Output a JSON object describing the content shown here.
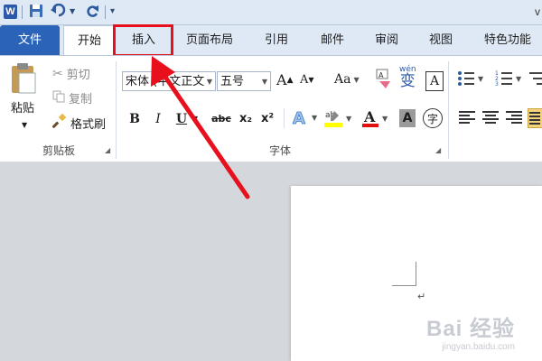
{
  "qat": {
    "logo_letter": "W",
    "title_fragment": "v"
  },
  "tabs": [
    {
      "label": "文件"
    },
    {
      "label": "开始"
    },
    {
      "label": "插入"
    },
    {
      "label": "页面布局"
    },
    {
      "label": "引用"
    },
    {
      "label": "邮件"
    },
    {
      "label": "审阅"
    },
    {
      "label": "视图"
    },
    {
      "label": "特色功能"
    }
  ],
  "clipboard": {
    "paste_label": "粘贴",
    "cut_label": "剪切",
    "copy_label": "复制",
    "format_painter_label": "格式刷",
    "group_label": "剪贴板"
  },
  "font": {
    "font_name": "宋体 (中文正文",
    "font_size": "五号",
    "group_label": "字体",
    "change_case": "Aa",
    "clear_format_text": "A",
    "pinyin_top": "wén",
    "pinyin_char": "变",
    "border_char": "A",
    "bold": "B",
    "italic": "I",
    "underline": "U",
    "strike": "abc",
    "subscript": "x₂",
    "superscript": "x²",
    "shade_char": "A",
    "enclose_char": "字"
  },
  "watermark": {
    "main": "Bai 经验",
    "sub": "jingyan.baidu.com"
  },
  "colors": {
    "file_tab": "#2a63b8",
    "highlight_red": "#e8101c",
    "ribbon_bg": "#ffffff",
    "tab_bar_bg": "#dfe9f5"
  }
}
